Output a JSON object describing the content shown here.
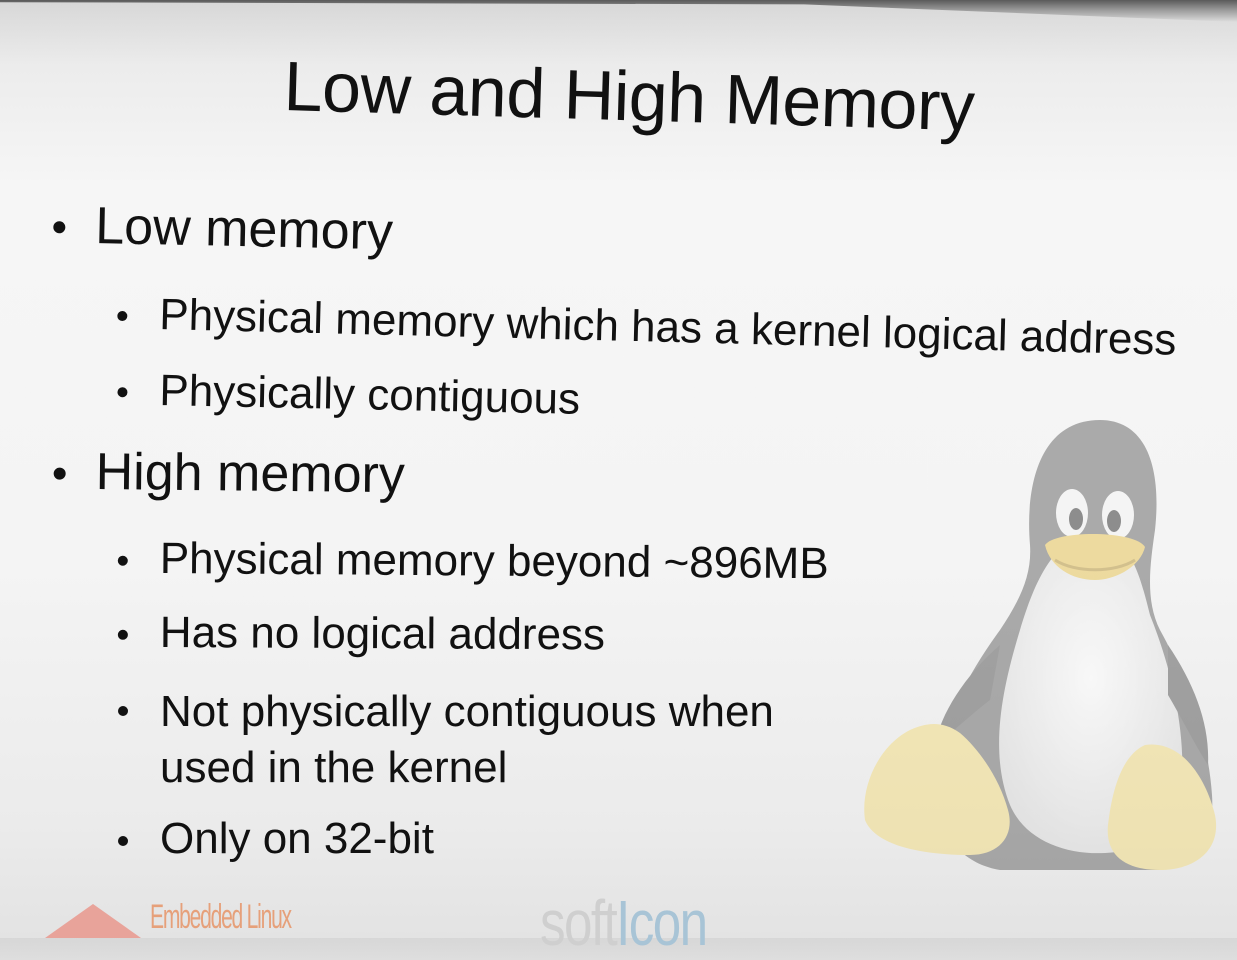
{
  "slide": {
    "title": "Low and High Memory",
    "bullets": [
      {
        "text": "Low memory",
        "sub": [
          "Physical memory which has a kernel logical address",
          "Physically contiguous"
        ]
      },
      {
        "text": "High memory",
        "sub": [
          "Physical memory beyond ~896MB",
          "Has no logical address",
          "Not physically contiguous when",
          "used in the kernel",
          "Only on 32-bit"
        ]
      }
    ]
  },
  "footer": {
    "logo_left_text": "Embedded Linux",
    "logo_right_text_a": "soft",
    "logo_right_text_b": "Icon"
  },
  "watermark": {
    "icon": "tux-penguin-icon"
  },
  "colors": {
    "text": "#111111",
    "background": "#f4f4f4",
    "tux_yellow": "#f2dc86",
    "logo_orange": "#e6a07a"
  }
}
